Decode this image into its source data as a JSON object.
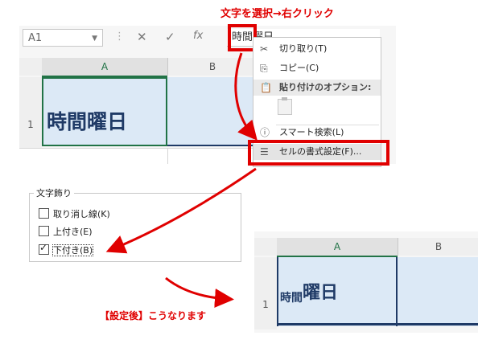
{
  "top_caption": "文字を選択→右クリック",
  "excel_top": {
    "name_box": "A1",
    "formula_text": "時間曜日",
    "col_a": "A",
    "col_b": "B",
    "row_1": "1",
    "cell_a1": "時間曜日"
  },
  "context_menu": {
    "items": [
      {
        "label": "切り取り(T)",
        "icon": "scissors-icon"
      },
      {
        "label": "コピー(C)",
        "icon": "copy-icon"
      },
      {
        "label": "貼り付けのオプション:",
        "icon": "paste-icon"
      },
      {
        "label": "スマート検索(L)",
        "icon": "info-icon"
      },
      {
        "label": "セルの書式設定(F)...",
        "icon": "format-cells-icon"
      }
    ]
  },
  "font_effects": {
    "legend": "文字飾り",
    "options": [
      {
        "label": "取り消し線(K)",
        "checked": false
      },
      {
        "label": "上付き(E)",
        "checked": false
      },
      {
        "label": "下付き(B)",
        "checked": true
      }
    ]
  },
  "excel_bottom": {
    "col_a": "A",
    "col_b": "B",
    "row_1": "1",
    "subscript_text": "時間",
    "normal_text": "曜日"
  },
  "bottom_caption": "【設定後】こうなります",
  "colors": {
    "accent_red": "#e00000",
    "excel_green": "#217346",
    "cell_fill": "#dce9f6",
    "text_navy": "#1f3a66"
  }
}
